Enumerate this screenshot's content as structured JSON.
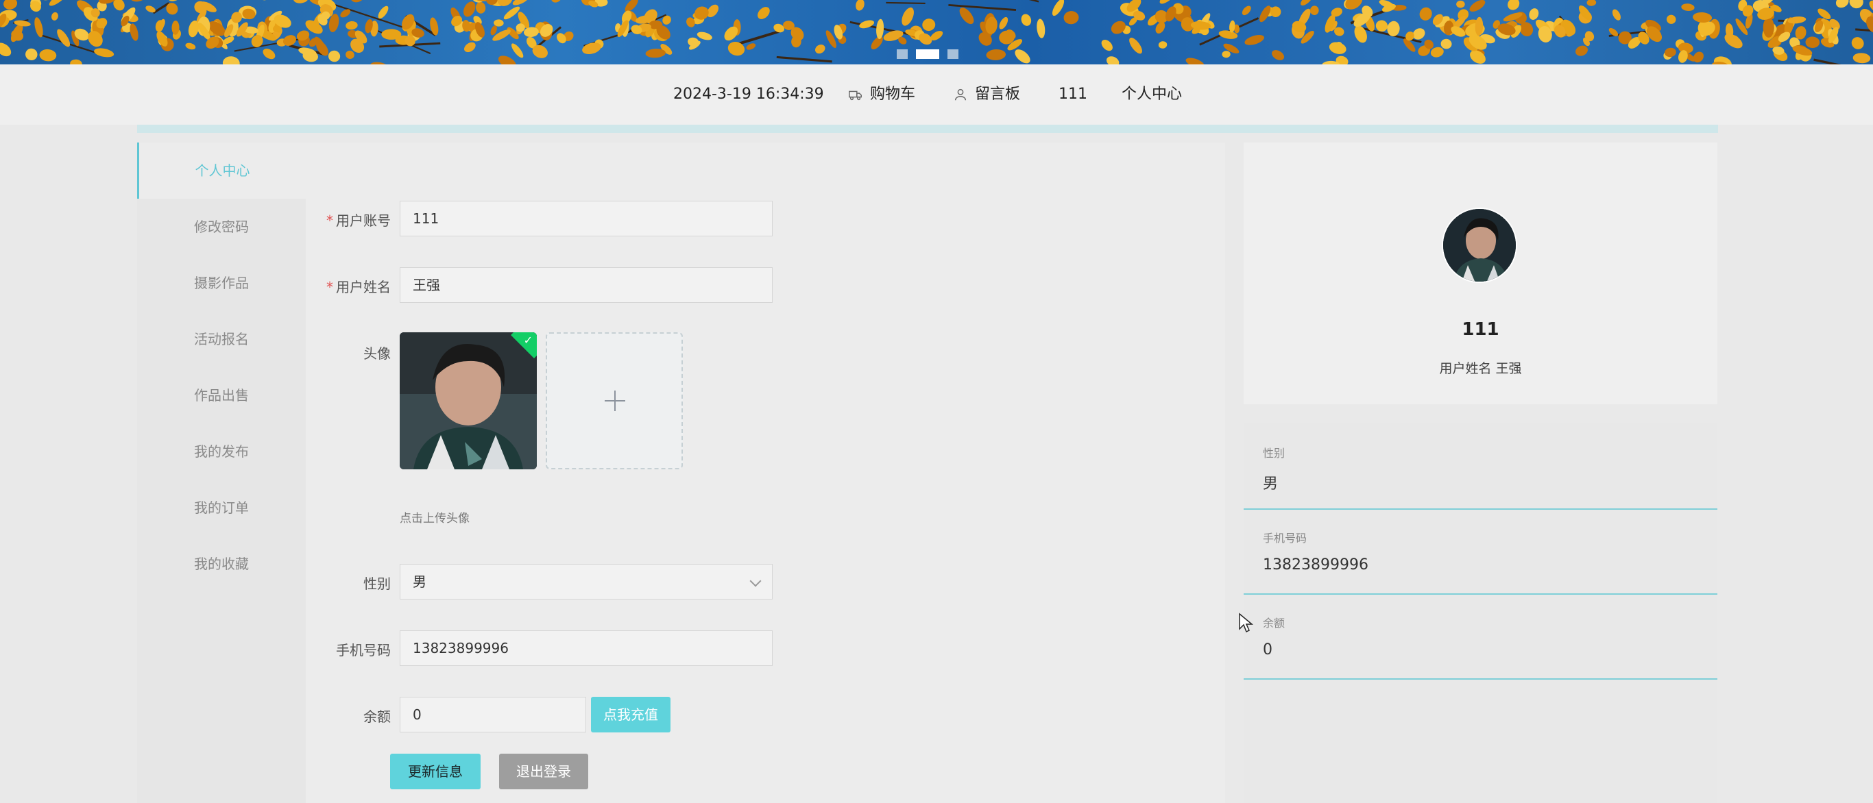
{
  "banner": {
    "carousel_dots": 3,
    "active_dot": 2
  },
  "nav": {
    "datetime": "2024-3-19 16:34:39",
    "cart_label": "购物车",
    "message_board_label": "留言板",
    "username": "111",
    "personal_center_label": "个人中心",
    "cart_icon": "truck-icon",
    "message_icon": "user-icon"
  },
  "sidebar": {
    "items": [
      {
        "label": "个人中心",
        "active": true
      },
      {
        "label": "修改密码",
        "active": false
      },
      {
        "label": "摄影作品",
        "active": false
      },
      {
        "label": "活动报名",
        "active": false
      },
      {
        "label": "作品出售",
        "active": false
      },
      {
        "label": "我的发布",
        "active": false
      },
      {
        "label": "我的订单",
        "active": false
      },
      {
        "label": "我的收藏",
        "active": false
      }
    ]
  },
  "form": {
    "account_label": "用户账号",
    "account_value": "111",
    "name_label": "用户姓名",
    "name_value": "王强",
    "avatar_label": "头像",
    "upload_hint": "点击上传头像",
    "gender_label": "性别",
    "gender_value": "男",
    "phone_label": "手机号码",
    "phone_value": "13823899996",
    "balance_label": "余额",
    "balance_value": "0",
    "recharge_button": "点我充值",
    "update_button": "更新信息",
    "logout_button": "退出登录"
  },
  "profile": {
    "username": "111",
    "subtitle": "用户姓名 王强",
    "info": [
      {
        "label": "性别",
        "value": "男"
      },
      {
        "label": "手机号码",
        "value": "13823899996"
      },
      {
        "label": "余额",
        "value": "0"
      }
    ]
  },
  "colors": {
    "accent": "#5fc6d4",
    "logout_gray": "#9e9e9e",
    "required": "#e05252"
  }
}
